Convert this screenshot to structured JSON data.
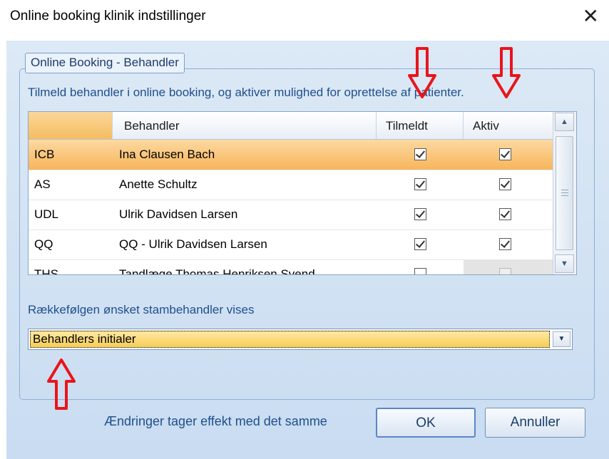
{
  "window": {
    "title": "Online booking klinik indstillinger",
    "close_glyph": "✕"
  },
  "group": {
    "title": "Online Booking - Behandler",
    "instruction": "Tilmeld behandler i online booking, og aktiver mulighed for oprettelse af patienter."
  },
  "grid": {
    "columns": [
      "",
      "Behandler",
      "Tilmeldt",
      "Aktiv"
    ],
    "rows": [
      {
        "code": "ICB",
        "name": "Ina Clausen Bach",
        "tilmeldt": true,
        "aktiv": true,
        "selected": true
      },
      {
        "code": "AS",
        "name": "Anette Schultz",
        "tilmeldt": true,
        "aktiv": true
      },
      {
        "code": "UDL",
        "name": "Ulrik Davidsen Larsen",
        "tilmeldt": true,
        "aktiv": true
      },
      {
        "code": "QQ",
        "name": "QQ - Ulrik Davidsen Larsen",
        "tilmeldt": true,
        "aktiv": true
      },
      {
        "code": "THS",
        "name": "Tandlæge Thomas Henriksen Svend",
        "tilmeldt": false,
        "aktiv": false,
        "aktiv_disabled": true
      }
    ]
  },
  "order": {
    "label": "Rækkefølgen ønsket stambehandler vises",
    "selected": "Behandlers initialer"
  },
  "footer": {
    "note": "Ændringer tager effekt med det samme",
    "ok_label": "OK",
    "cancel_label": "Annuller"
  },
  "colors": {
    "selection": "#f7b55a",
    "arrow": "#e8151b",
    "accent_text": "#1f4f8c"
  },
  "icons": {
    "close": "close-icon",
    "scroll_up": "chevron-up-icon",
    "scroll_down": "chevron-down-icon",
    "dropdown": "chevron-down-icon",
    "annotation": "arrow-icon"
  }
}
